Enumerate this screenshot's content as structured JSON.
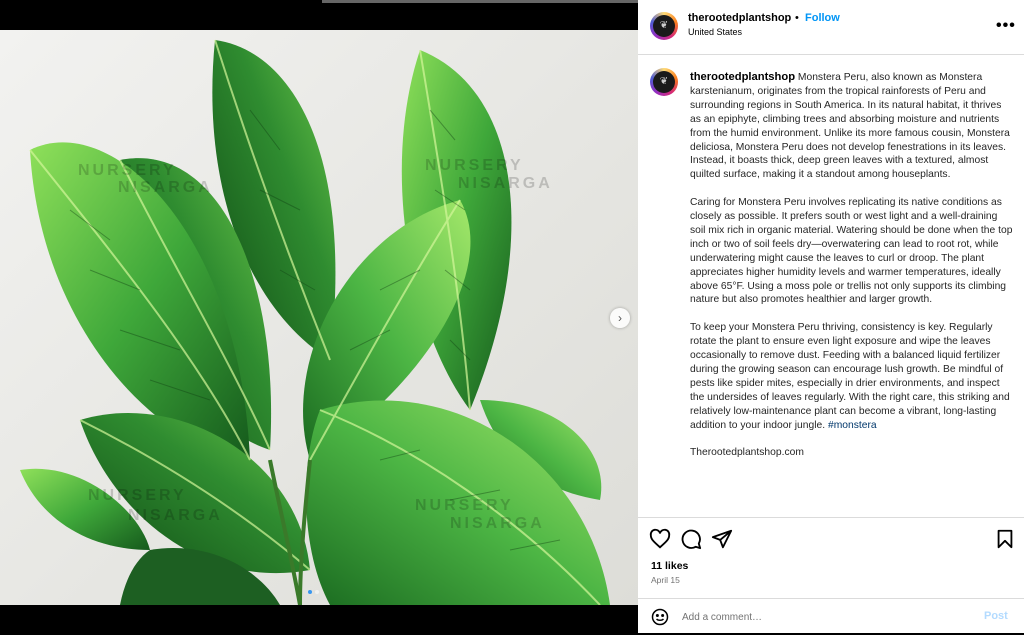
{
  "post": {
    "username": "therootedplantshop",
    "follow_label": "Follow",
    "separator": "•",
    "location": "United States",
    "more_label": "•••",
    "caption_paragraphs": [
      "Monstera Peru, also known as Monstera karstenianum, originates from the tropical rainforests of Peru and surrounding regions in South America. In its natural habitat, it thrives as an epiphyte, climbing trees and absorbing moisture and nutrients from the humid environment. Unlike its more famous cousin, Monstera deliciosa, Monstera Peru does not develop fenestrations in its leaves. Instead, it boasts thick, deep green leaves with a textured, almost quilted surface, making it a standout among houseplants.",
      "Caring for Monstera Peru involves replicating its native conditions as closely as possible. It prefers south or west light and a well-draining soil mix rich in organic material. Watering should be done when the top inch or two of soil feels dry—overwatering can lead to root rot, while underwatering might cause the leaves to curl or droop. The plant appreciates higher humidity levels and warmer temperatures, ideally above 65°F. Using a moss pole or trellis not only supports its climbing nature but also promotes healthier and larger growth.",
      "To keep your Monstera Peru thriving, consistency is key. Regularly rotate the plant to ensure even light exposure and wipe the leaves occasionally to remove dust. Feeding with a balanced liquid fertilizer during the growing season can encourage lush growth. Be mindful of pests like spider mites, especially in drier environments, and inspect the undersides of leaves regularly. With the right care, this striking and relatively low-maintenance plant can become a vibrant, long-lasting addition to your indoor jungle."
    ],
    "hashtag": "#monstera",
    "website": "Therootedplantshop.com",
    "likes": "11 likes",
    "date": "April 15",
    "comment_placeholder": "Add a comment…",
    "post_label": "Post",
    "next_arrow": "›",
    "avatar_glyph": "❦",
    "watermark_lines": [
      "NURSERY",
      "NISARGA"
    ]
  },
  "icons": {
    "like": "heart-icon",
    "comment": "comment-icon",
    "share": "share-icon",
    "save": "bookmark-icon",
    "emoji": "emoji-icon",
    "options": "more-options-icon"
  },
  "colors": {
    "accent": "#0095f6",
    "post_disabled": "#b3dbff",
    "hashtag": "#00376b",
    "leaf_dark": "#1f6a24",
    "leaf_light": "#7fd34a"
  }
}
